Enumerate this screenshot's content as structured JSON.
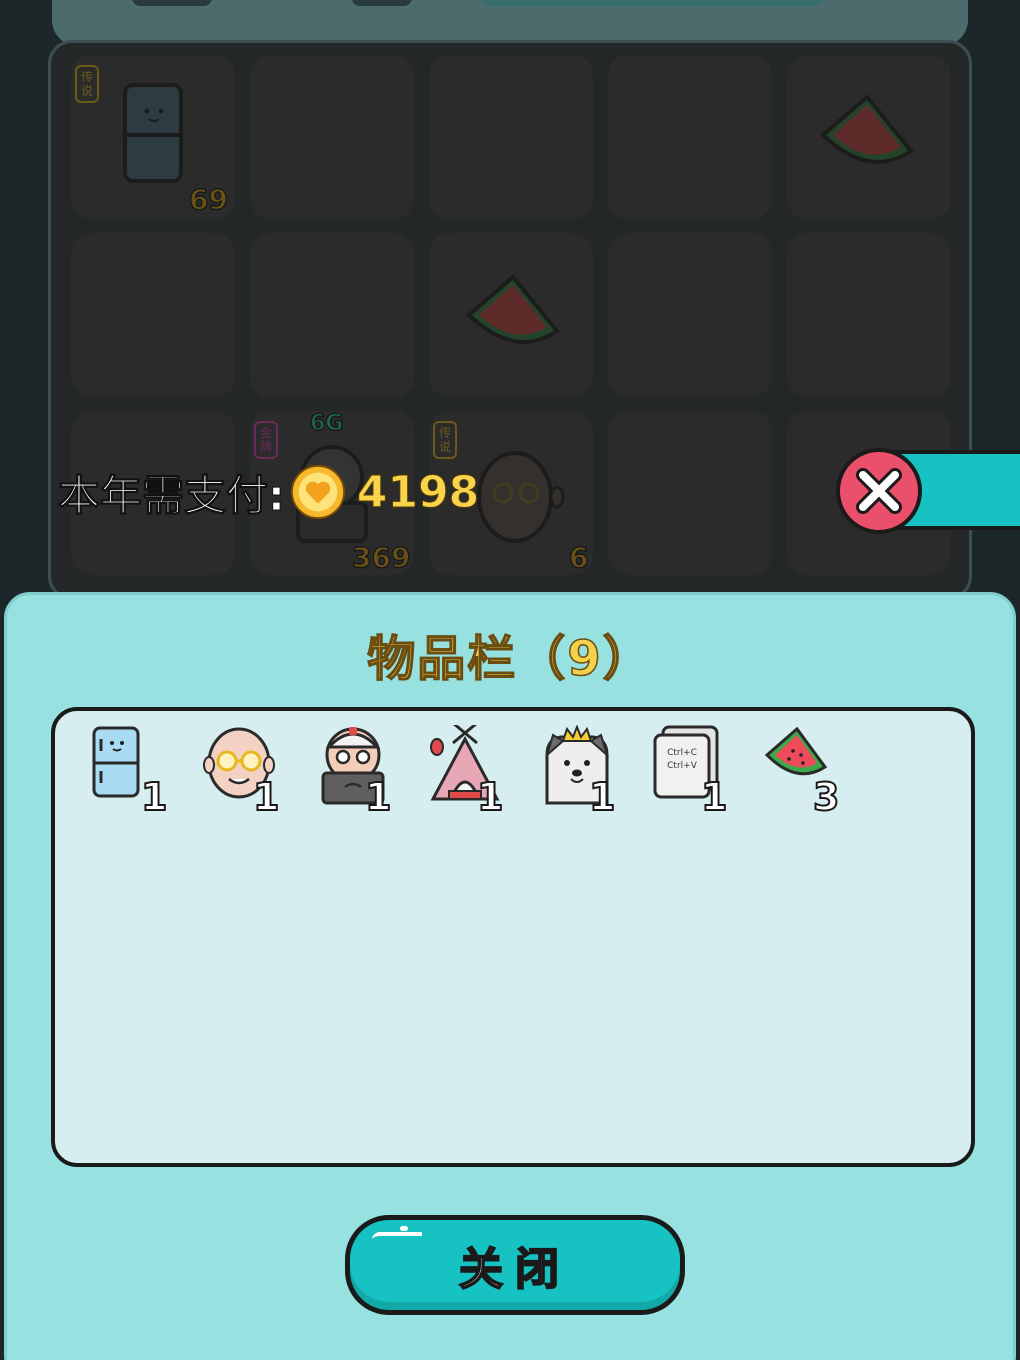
{
  "board": {
    "cells": [
      {
        "tag": "传说",
        "number": "69"
      },
      {
        "tag": "传说",
        "number": "6"
      },
      {
        "tag": "金牌",
        "number": "369",
        "badge": "6G"
      }
    ]
  },
  "payment": {
    "label": "本年需支付:",
    "amount": "4198"
  },
  "inventory": {
    "title": "物品栏（9）",
    "items": [
      {
        "icon": "refrigerator-icon",
        "count": "1"
      },
      {
        "icon": "bald-old-man-glasses-icon",
        "count": "1"
      },
      {
        "icon": "programmer-with-cap-icon",
        "count": "1"
      },
      {
        "icon": "pink-tent-house-icon",
        "count": "1"
      },
      {
        "icon": "husky-with-crown-icon",
        "count": "1"
      },
      {
        "icon": "ctrl-c-ctrl-v-cards-icon",
        "count": "1",
        "lines": [
          "Ctrl+C",
          "Ctrl+V"
        ]
      },
      {
        "icon": "watermelon-slice-icon",
        "count": "3"
      }
    ]
  },
  "close_button": {
    "label": "关闭"
  },
  "colors": {
    "panel": "#97e2e1",
    "button": "#17c3c2",
    "accent_gold": "#f4d14a",
    "danger": "#ea4f6b"
  }
}
